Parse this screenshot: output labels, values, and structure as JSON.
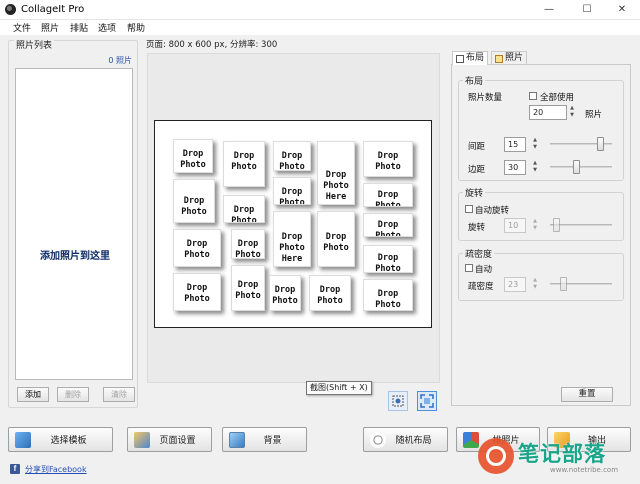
{
  "window": {
    "title": "CollageIt Pro",
    "minimize_glyph": "—",
    "maximize_glyph": "☐",
    "close_glyph": "✕"
  },
  "menu": [
    "文件",
    "照片",
    "排贴",
    "选项",
    "帮助"
  ],
  "photo_list": {
    "title": "照片列表",
    "count": "0 照片",
    "hint": "添加照片到这里",
    "buttons": {
      "add": "添加",
      "remove": "删除",
      "clear": "清除"
    }
  },
  "page_info": "页面: 800 x 600 px, 分辨率: 300",
  "canvas": {
    "cells": [
      "Drop\nPhoto",
      "Drop\nPhoto",
      "Drop\nPhoto",
      "Drop\nPhoto\nHere",
      "Drop\nPhoto",
      "Drop\nPhoto",
      "Drop\nPhoto",
      "Drop\nPhoto",
      "Drop\nPhoto",
      "Drop\nPhoto",
      "Drop\nPhoto\nHere",
      "Drop\nPhoto\nHere",
      "Drop\nPhoto",
      "Drop\nPhoto",
      "Drop\nPhoto",
      "Drop\nPhoto",
      "Drop\nPhoto",
      "Drop\nPhoto",
      "Drop\nPhoto"
    ]
  },
  "tooltip": "截图(Shift + X)",
  "tabs": {
    "layout": "布局",
    "photo": "照片"
  },
  "layout_group": {
    "title": "布局",
    "photo_count_label": "照片数量",
    "use_all_label": "全部使用",
    "photo_count_value": "20",
    "photo_unit": "照片",
    "spacing_label": "间距",
    "spacing_value": "15",
    "spacing_slider_fraction": 0.85,
    "margin_label": "边距",
    "margin_value": "30",
    "margin_slider_fraction": 0.42
  },
  "rotation_group": {
    "title": "旋转",
    "auto_label": "自动旋转",
    "rotation_label": "旋转",
    "rotation_value": "10",
    "rotation_slider_fraction": 0.05
  },
  "density_group": {
    "title": "疏密度",
    "auto_label": "自动",
    "density_label": "疏密度",
    "density_value": "23",
    "density_slider_fraction": 0.18
  },
  "reset_label": "重置",
  "bottom": {
    "choose_template": "选择模板",
    "page_setup": "页面设置",
    "background": "背景",
    "random_layout": "随机布局",
    "collage": "排照片",
    "export": "输出"
  },
  "share_facebook": "分享到Facebook",
  "watermark": {
    "name": "笔记部落",
    "url": "www.notetribe.com"
  },
  "colors": {
    "accent_blue": "#2a4fa3",
    "hint_navy": "#0f2c66",
    "watermark_green": "#1aa58a",
    "watermark_orange": "#e8502a"
  }
}
